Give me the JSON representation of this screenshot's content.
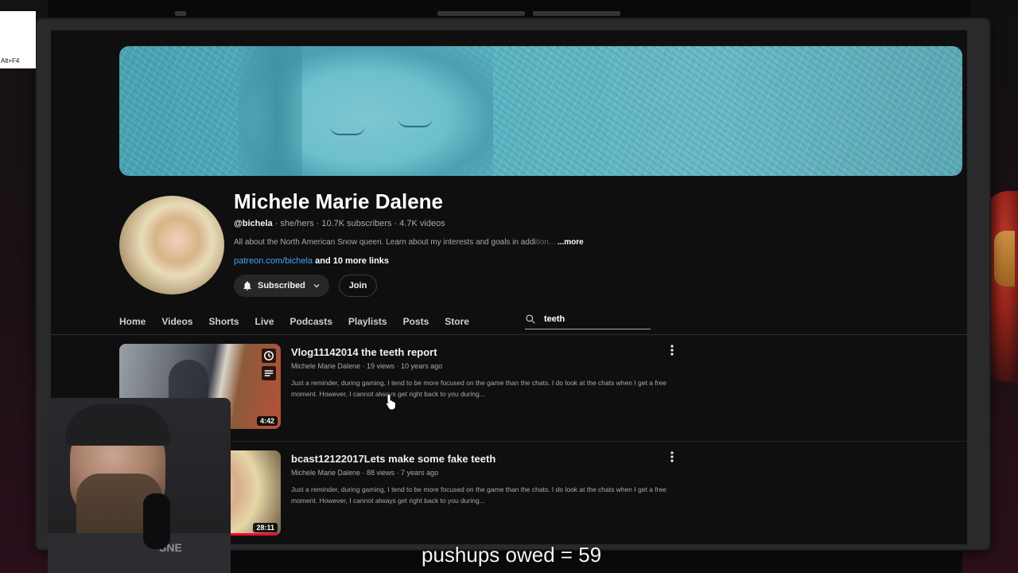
{
  "overlay": {
    "altf4_label": "Alt+F4",
    "pushups_text": "pushups owed = 59"
  },
  "channel": {
    "name": "Michele Marie Dalene",
    "handle": "@bichela",
    "meta_rest": " · she/hers · 10.7K subscribers · 4.7K videos",
    "description": "All about the North American Snow queen. Learn about my interests and goals in addi",
    "description_fade": "tion...",
    "description_more": "...more",
    "link": "patreon.com/bichela",
    "more_links": " and 10 more links",
    "subscribed_label": "Subscribed",
    "join_label": "Join"
  },
  "tabs": [
    "Home",
    "Videos",
    "Shorts",
    "Live",
    "Podcasts",
    "Playlists",
    "Posts",
    "Store"
  ],
  "search": {
    "value": "teeth",
    "placeholder": "Search"
  },
  "results": [
    {
      "title": "Vlog11142014 the teeth report",
      "meta": "Michele Marie Dalene · 19 views · 10 years ago",
      "description": "Just a reminder, during gaming, I tend to be more focused on the game than the chats. I do look at the chats when I get a free moment. However, I cannot always get right back to you during...",
      "duration": "4:42"
    },
    {
      "title": "bcast12122017Lets make some fake teeth",
      "meta": "Michele Marie Dalene · 88 views · 7 years ago",
      "description": "Just a reminder, during gaming, I tend to be more focused on the game than the chats. I do look at the chats when I get a free moment. However, I cannot always get right back to you during...",
      "duration": "28:11"
    }
  ],
  "webcam": {
    "shirt_logo": "SNE"
  },
  "colors": {
    "background": "#0f0f0f",
    "link": "#3ea6ff",
    "progress": "#ff0033",
    "banner": "#5bb4c2"
  },
  "icons": [
    "bell-icon",
    "chevron-down-icon",
    "search-icon",
    "more-vert-icon",
    "watch-later-icon",
    "add-to-queue-icon",
    "mouse-cursor-icon"
  ]
}
